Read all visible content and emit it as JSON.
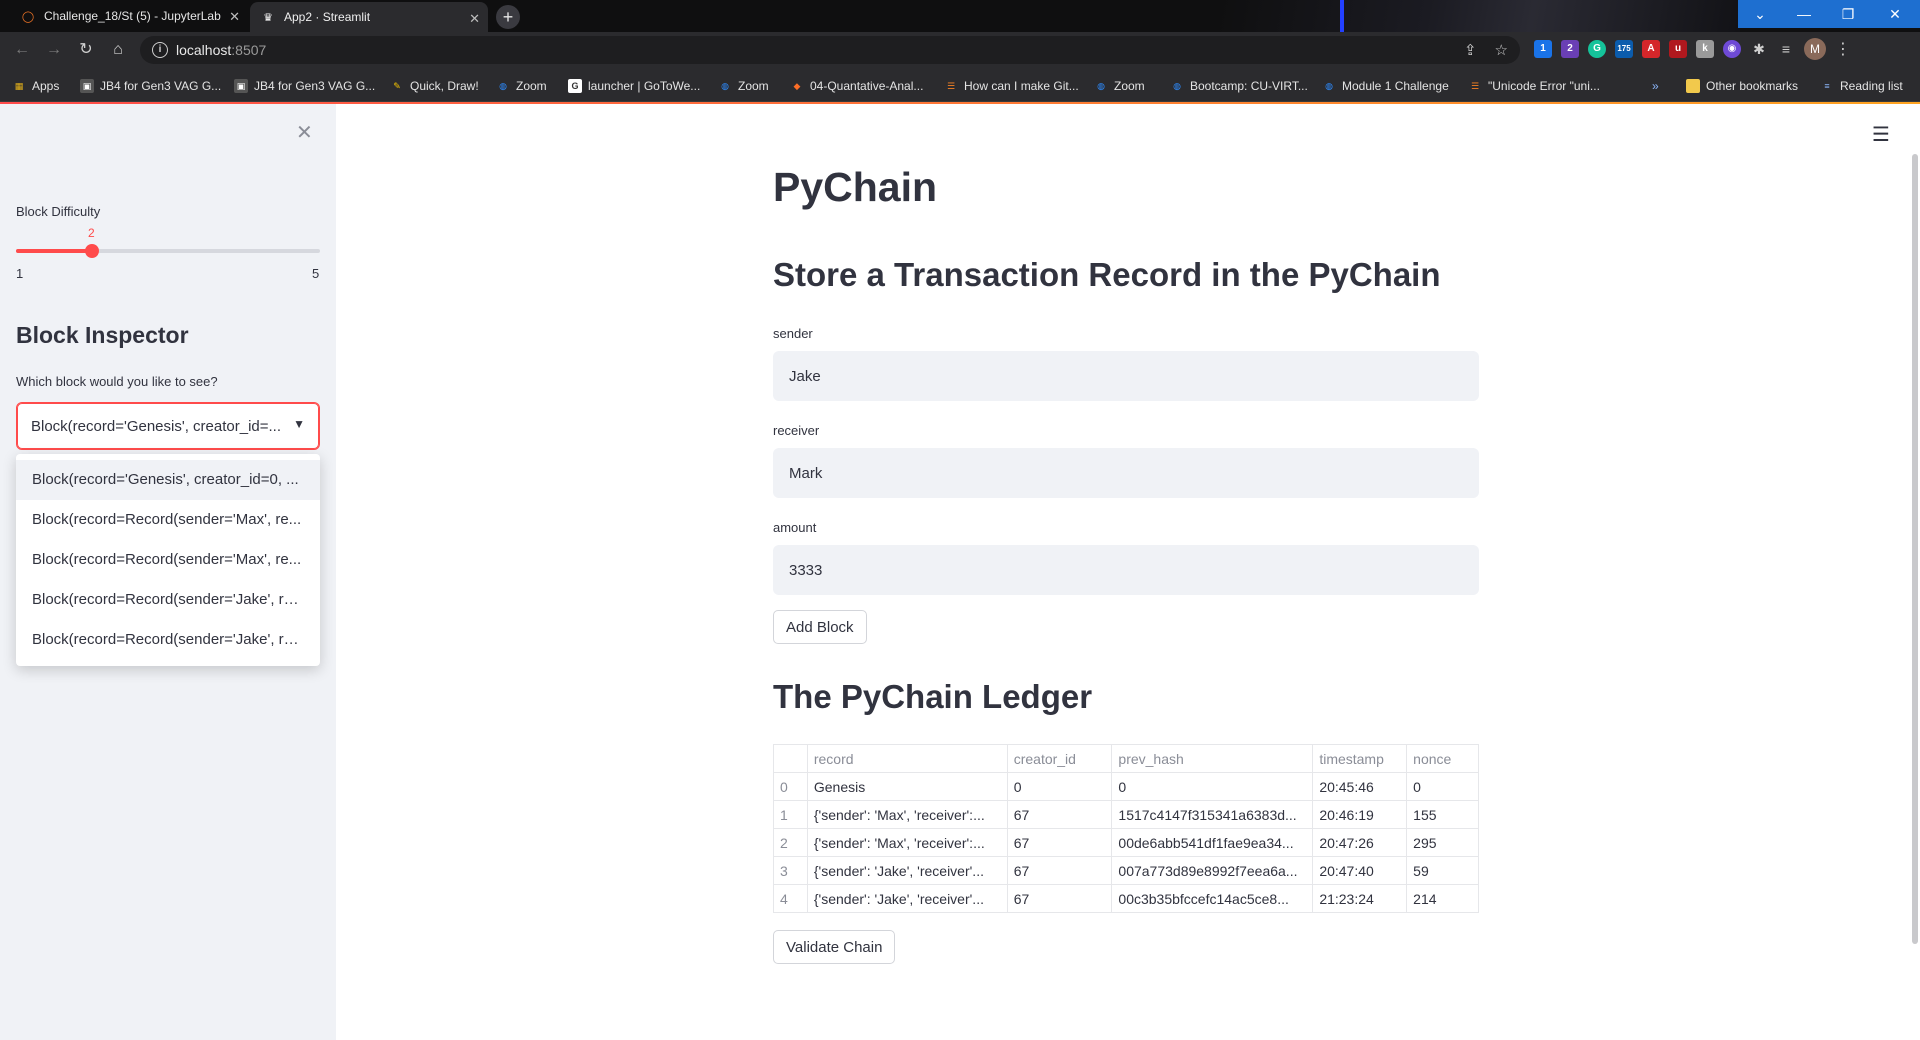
{
  "browser": {
    "tabs": [
      {
        "title": "Challenge_18/St (5) - JupyterLab",
        "icon": "jupyter-icon"
      },
      {
        "title": "App2 · Streamlit",
        "icon": "streamlit-icon"
      }
    ],
    "url_host": "localhost",
    "url_port": ":8507",
    "bookmarks": [
      "Apps",
      "JB4 for Gen3 VAG G...",
      "JB4 for Gen3 VAG G...",
      "Quick, Draw!",
      "Zoom",
      "launcher | GoToWe...",
      "Zoom",
      "04-Quantative-Anal...",
      "How can I make Git...",
      "Zoom",
      "Bootcamp: CU-VIRT...",
      "Module 1 Challenge",
      "\"Unicode Error \"uni...",
      "»",
      "Other bookmarks",
      "Reading list"
    ],
    "profile_initial": "M",
    "ext_badges": [
      "1",
      "2",
      "175"
    ]
  },
  "sidebar": {
    "slider": {
      "label": "Block Difficulty",
      "value": 2,
      "min": 1,
      "max": 5
    },
    "heading": "Block Inspector",
    "select_label": "Which block would you like to see?",
    "select_value": "Block(record='Genesis', creator_id=...",
    "options": [
      "Block(record='Genesis', creator_id=0, ...",
      "Block(record=Record(sender='Max', re...",
      "Block(record=Record(sender='Max', re...",
      "Block(record=Record(sender='Jake', re...",
      "Block(record=Record(sender='Jake', re..."
    ]
  },
  "main": {
    "title": "PyChain",
    "section1": "Store a Transaction Record in the PyChain",
    "fields": [
      {
        "label": "sender",
        "value": "Jake"
      },
      {
        "label": "receiver",
        "value": "Mark"
      },
      {
        "label": "amount",
        "value": "3333"
      }
    ],
    "add_button": "Add Block",
    "section2": "The PyChain Ledger",
    "table": {
      "columns": [
        "",
        "record",
        "creator_id",
        "prev_hash",
        "timestamp",
        "nonce"
      ],
      "rows": [
        [
          "0",
          "Genesis",
          "0",
          "0",
          "20:45:46",
          "0"
        ],
        [
          "1",
          "{'sender': 'Max', 'receiver':...",
          "67",
          "1517c4147f315341a6383d...",
          "20:46:19",
          "155"
        ],
        [
          "2",
          "{'sender': 'Max', 'receiver':...",
          "67",
          "00de6abb541df1fae9ea34...",
          "20:47:26",
          "295"
        ],
        [
          "3",
          "{'sender': 'Jake', 'receiver'...",
          "67",
          "007a773d89e8992f7eea6a...",
          "20:47:40",
          "59"
        ],
        [
          "4",
          "{'sender': 'Jake', 'receiver'...",
          "67",
          "00c3b35bfccefc14ac5ce8...",
          "21:23:24",
          "214"
        ]
      ]
    },
    "validate_button": "Validate Chain"
  },
  "colors": {
    "accent": "#ff4b4b",
    "sidebar_bg": "#f0f2f6",
    "text": "#31333f"
  }
}
